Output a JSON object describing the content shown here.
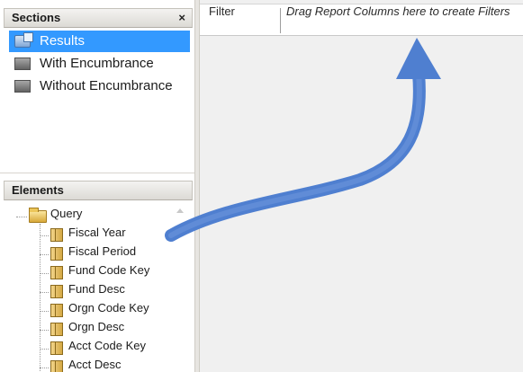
{
  "sections_panel": {
    "title": "Sections",
    "close_glyph": "×",
    "items": [
      {
        "label": "Results",
        "icon": "results-icon",
        "selected": true
      },
      {
        "label": "With Encumbrance",
        "icon": "section-icon",
        "selected": false
      },
      {
        "label": "Without Encumbrance",
        "icon": "section-icon",
        "selected": false
      }
    ]
  },
  "elements_panel": {
    "title": "Elements",
    "root": {
      "label": "Query",
      "icon": "folder-icon"
    },
    "columns": [
      "Fiscal Year",
      "Fiscal Period",
      "Fund Code Key",
      "Fund Desc",
      "Orgn Code Key",
      "Orgn Desc",
      "Acct Code Key",
      "Acct Desc"
    ]
  },
  "filter_bar": {
    "label": "Filter",
    "drop_hint": "Drag Report Columns here to create Filters"
  },
  "colors": {
    "selection": "#3399ff",
    "annotation_arrow": "#4f7fd0"
  }
}
